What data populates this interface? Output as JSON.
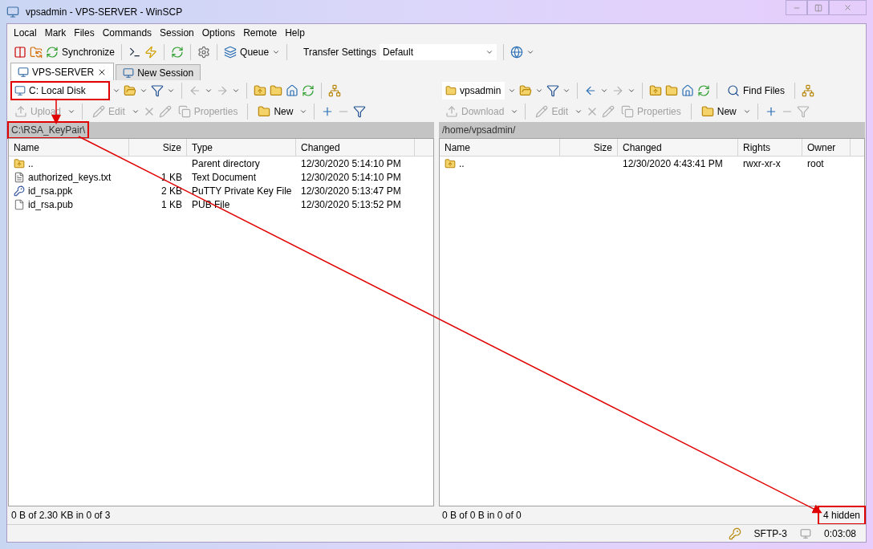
{
  "window": {
    "title": "vpsadmin - VPS-SERVER - WinSCP"
  },
  "menu": [
    "Local",
    "Mark",
    "Files",
    "Commands",
    "Session",
    "Options",
    "Remote",
    "Help"
  ],
  "toolbar": {
    "synchronize": "Synchronize",
    "queue": "Queue",
    "transfer_settings_label": "Transfer Settings",
    "transfer_settings_value": "Default"
  },
  "tabs": [
    {
      "label": "VPS-SERVER",
      "selected": true
    },
    {
      "label": "New Session",
      "selected": false
    }
  ],
  "local": {
    "drive": {
      "label": "C: Local Disk",
      "highlighted": true
    },
    "actions": [
      {
        "label": "Upload",
        "disabled": true
      },
      {
        "label": "Edit",
        "disabled": true
      },
      {
        "label": "Properties",
        "disabled": true
      },
      {
        "label": "New",
        "disabled": false
      }
    ],
    "path": {
      "text": "C:\\RSA_KeyPair\\",
      "highlighted": true
    },
    "columns": [
      "Name",
      "Size",
      "Type",
      "Changed"
    ],
    "rows": [
      {
        "kind": "parent",
        "cells": [
          "..",
          "",
          "Parent directory",
          "12/30/2020  5:14:10 PM"
        ]
      },
      {
        "kind": "text",
        "cells": [
          "authorized_keys.txt",
          "1 KB",
          "Text Document",
          "12/30/2020  5:14:10 PM"
        ]
      },
      {
        "kind": "key",
        "cells": [
          "id_rsa.ppk",
          "2 KB",
          "PuTTY Private Key File",
          "12/30/2020  5:13:47 PM"
        ]
      },
      {
        "kind": "file",
        "cells": [
          "id_rsa.pub",
          "1 KB",
          "PUB File",
          "12/30/2020  5:13:52 PM"
        ]
      }
    ],
    "status": "0 B of 2.30 KB in 0 of 3"
  },
  "remote": {
    "folder": "vpsadmin",
    "find_files": "Find Files",
    "actions": [
      {
        "label": "Download",
        "disabled": true
      },
      {
        "label": "Edit",
        "disabled": true
      },
      {
        "label": "Properties",
        "disabled": true
      },
      {
        "label": "New",
        "disabled": false
      }
    ],
    "path": {
      "text": "/home/vpsadmin/",
      "highlighted": false
    },
    "columns": [
      "Name",
      "Size",
      "Changed",
      "Rights",
      "Owner"
    ],
    "rows": [
      {
        "kind": "parent",
        "cells": [
          "..",
          "",
          "12/30/2020 4:43:41 PM",
          "rwxr-xr-x",
          "root"
        ]
      }
    ],
    "status": "0 B of 0 B in 0 of 0",
    "hidden": {
      "text": "4 hidden",
      "highlighted": true
    }
  },
  "status_bar": {
    "protocol": "SFTP-3",
    "elapsed": "0:03:08"
  }
}
